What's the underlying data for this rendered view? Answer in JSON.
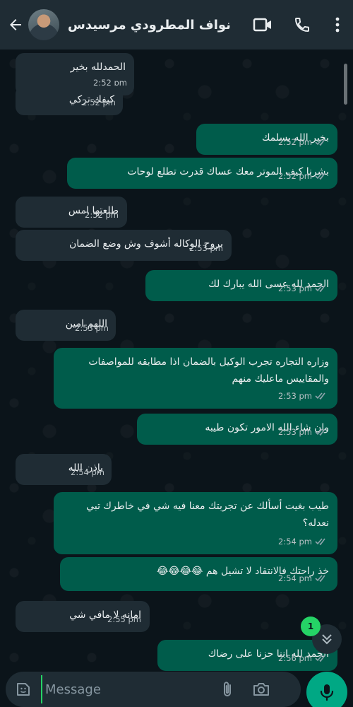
{
  "header": {
    "contact_name": "نواف المطرودي مرسيدس"
  },
  "messages": [
    {
      "dir": "in",
      "text": "الحمدلله بخير",
      "time": "2:52 pm"
    },
    {
      "dir": "in",
      "text": "كيفك تركي",
      "time": "2:52 pm"
    },
    {
      "dir": "out",
      "text": "بخير الله يسلمك",
      "time": "2:52 pm"
    },
    {
      "dir": "out",
      "text": "بشرنا كيف الموتر معك عساك قدرت تطلع لوحات",
      "time": "2:52 pm"
    },
    {
      "dir": "in",
      "text": "طلعتها امس",
      "time": "2:52 pm"
    },
    {
      "dir": "in",
      "text": "بروح الوكاله أشوف وش وضع الضمان",
      "time": "2:53 pm"
    },
    {
      "dir": "out",
      "text": "الحمد لله عسى الله يبارك لك",
      "time": "2:53 pm"
    },
    {
      "dir": "in",
      "text": "اللهم امين",
      "time": "2:53 pm"
    },
    {
      "dir": "out",
      "text": "وزاره التجاره تجرب الوكيل بالضمان اذا مطابقه للمواصفات والمقاييس ماعليك منهم",
      "time": "2:53 pm"
    },
    {
      "dir": "out",
      "text": "وان شاء الله الامور تكون طيبه",
      "time": "2:53 pm"
    },
    {
      "dir": "in",
      "text": "بإذن الله",
      "time": "2:54 pm"
    },
    {
      "dir": "out",
      "text": "طيب بغيت أسألك عن تجربتك معنا فيه شي في خاطرك تبي نعدله؟",
      "time": "2:54 pm"
    },
    {
      "dir": "out",
      "text": "خذ راحتك فالانتقاد لا تشيل هم 😂😂😂😂",
      "time": "2:54 pm"
    },
    {
      "dir": "in",
      "text": "امانه لا مافي شي",
      "time": "2:55 pm"
    },
    {
      "dir": "out",
      "text": "الحمد لله اننا حزنا على رضاك",
      "time": "2:56 pm"
    }
  ],
  "unread_count": "1",
  "input": {
    "placeholder": "Message"
  },
  "colors": {
    "incoming_bubble": "#1f2c34",
    "outgoing_bubble": "#005c4b",
    "accent": "#00a884",
    "read_ticks": "#53bdeb"
  }
}
